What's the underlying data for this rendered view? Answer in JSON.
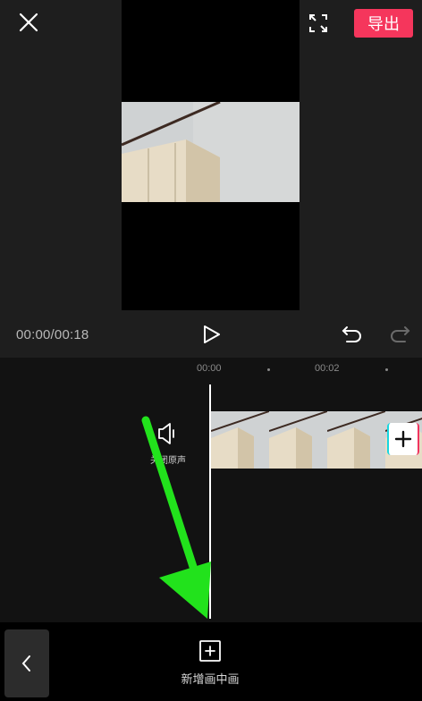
{
  "header": {
    "close_icon": "close-icon",
    "fullscreen_icon": "fullscreen-expand-icon",
    "export_label": "导出",
    "export_color": "#f5365c"
  },
  "playback": {
    "timecode": "00:00/00:18",
    "play_icon": "play-icon",
    "undo_icon": "undo-icon",
    "redo_icon": "redo-icon"
  },
  "timeline": {
    "ruler": [
      "00:00",
      "00:02"
    ],
    "mute_label": "关闭原声",
    "mute_icon": "speaker-icon",
    "add_clip_icon": "plus-icon"
  },
  "bottom": {
    "back_icon": "chevron-left-icon",
    "pip_label": "新增画中画",
    "pip_icon": "add-square-icon"
  },
  "annotation": {
    "arrow_color": "#22e21c"
  }
}
